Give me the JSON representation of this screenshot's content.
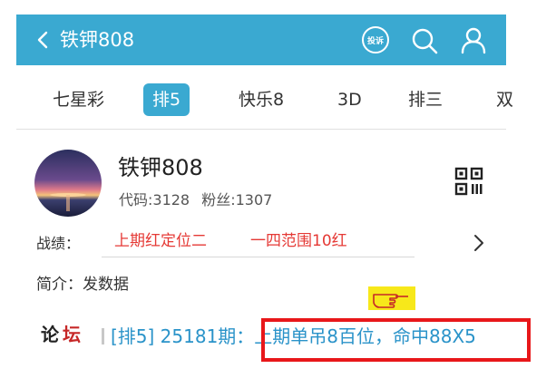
{
  "header": {
    "back_icon": "chevron-left-icon",
    "title": "铁钾808",
    "complain_label": "投诉",
    "search_icon": "search-icon",
    "user_icon": "user-icon",
    "color": "#3aa9d1"
  },
  "tabs": [
    {
      "label": "七星彩",
      "active": false
    },
    {
      "label": "排5",
      "active": true
    },
    {
      "label": "快乐8",
      "active": false
    },
    {
      "label": "3D",
      "active": false
    },
    {
      "label": "排三",
      "active": false
    },
    {
      "label": "双",
      "active": false
    }
  ],
  "profile": {
    "name": "铁钾808",
    "code": "代码:3128",
    "fans": "粉丝:1307",
    "qr_icon": "qr-code-icon"
  },
  "record": {
    "label": "战绩：",
    "items": [
      "上期红定位二",
      "一四范围10红"
    ],
    "color": "#e53935"
  },
  "intro": {
    "text": "简介：发数据"
  },
  "forum": {
    "label_1": "论",
    "label_2": "坛",
    "text": "[排5] 25181期：上期单吊8百位，命中88X5",
    "link_color": "#2a93c9",
    "highlight_color": "#e8171a"
  }
}
